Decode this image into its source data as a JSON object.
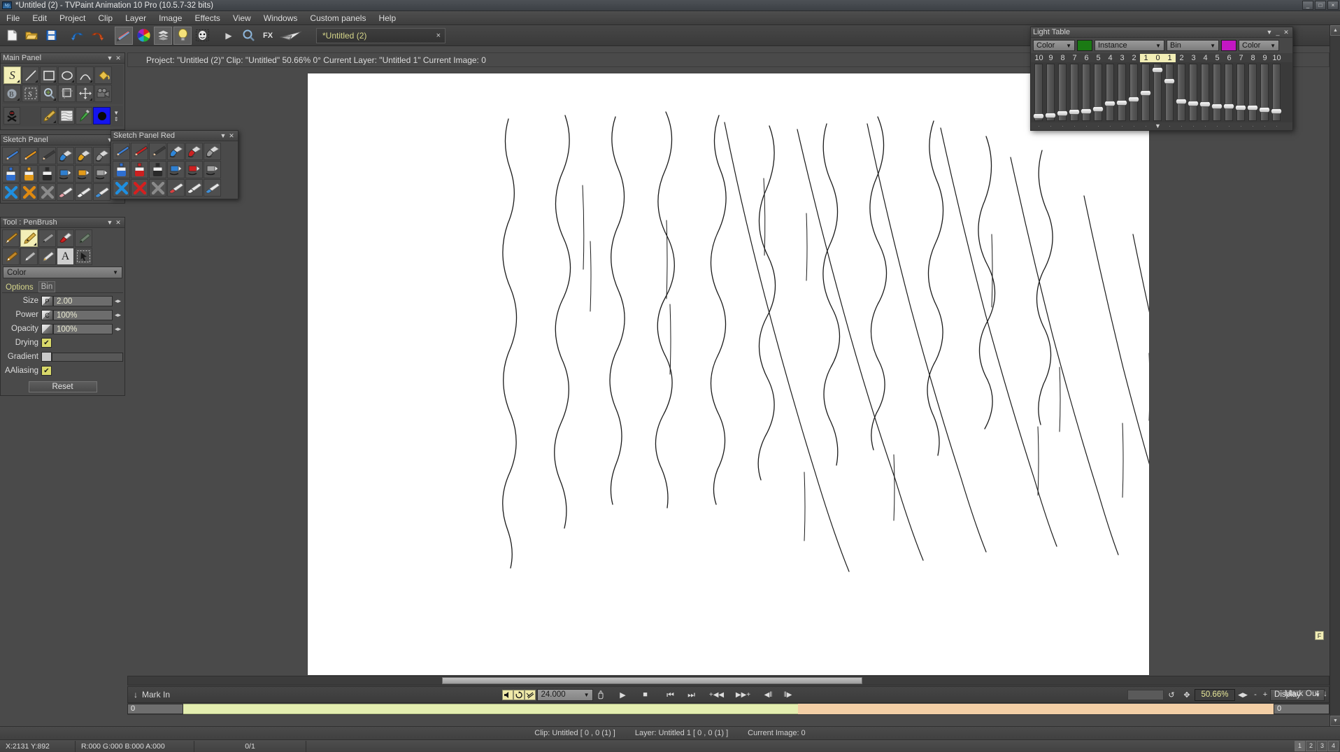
{
  "window": {
    "title": "*Untitled (2) - TVPaint Animation 10 Pro (10.5.7-32 bits)",
    "logo": "tvp",
    "minimize": "_",
    "maximize": "□",
    "close": "×"
  },
  "menu": {
    "items": [
      "File",
      "Edit",
      "Project",
      "Clip",
      "Layer",
      "Image",
      "Effects",
      "View",
      "Windows",
      "Custom panels",
      "Help"
    ]
  },
  "toolbar": {
    "buttons": [
      {
        "name": "new-file-icon",
        "glyph": "📄"
      },
      {
        "name": "open-folder-icon",
        "glyph": "📂"
      },
      {
        "name": "save-icon",
        "glyph": "💾"
      },
      {
        "name": "undo-icon",
        "glyph": "↶"
      },
      {
        "name": "redo-icon",
        "glyph": "↷"
      },
      {
        "name": "brushes-icon",
        "glyph": "✎"
      },
      {
        "name": "color-wheel-icon",
        "glyph": "◉"
      },
      {
        "name": "layers-icon",
        "glyph": "◈"
      },
      {
        "name": "light-bulb-icon",
        "glyph": "💡"
      },
      {
        "name": "mask-icon",
        "glyph": "☻"
      },
      {
        "name": "play-icon",
        "glyph": "▶"
      },
      {
        "name": "zoom-icon",
        "glyph": "🔍"
      },
      {
        "name": "fx-label",
        "glyph": "FX"
      },
      {
        "name": "paper-plane-icon",
        "glyph": "✈"
      }
    ],
    "tab_label": "*Untitled (2)",
    "tab_close": "×"
  },
  "main_panel": {
    "title": "Main Panel",
    "collapse": "▼",
    "close": "✕",
    "tools_row1": [
      {
        "name": "freehand-tool",
        "glyph": "S",
        "selected": true
      },
      {
        "name": "line-tool",
        "glyph": "╱",
        "selected": false
      },
      {
        "name": "rectangle-tool",
        "glyph": "▭",
        "selected": false
      },
      {
        "name": "ellipse-tool",
        "glyph": "◯",
        "selected": false
      },
      {
        "name": "curve-tool",
        "glyph": "∩",
        "selected": false
      },
      {
        "name": "fill-tool",
        "glyph": "🪣",
        "selected": false
      }
    ],
    "tools_row2": [
      {
        "name": "brush-select-tool",
        "glyph": "B",
        "selected": false
      },
      {
        "name": "selection-tool",
        "glyph": "S",
        "selected": false
      },
      {
        "name": "magnifier-tool",
        "glyph": "🔍",
        "selected": false
      },
      {
        "name": "crop-tool",
        "glyph": "⊐",
        "selected": false
      },
      {
        "name": "move-tool",
        "glyph": "✥",
        "selected": false
      },
      {
        "name": "camera-tool",
        "glyph": "🎥",
        "selected": false
      }
    ],
    "tools_row3": [
      {
        "name": "skull-eraser-icon",
        "glyph": "☠"
      },
      {
        "name": "pen-nib-icon",
        "glyph": "✒"
      },
      {
        "name": "paper-texture-icon",
        "glyph": "▨"
      },
      {
        "name": "eyedropper-icon",
        "glyph": "💉"
      },
      {
        "name": "color-swatch-icon",
        "glyph": "●"
      },
      {
        "name": "color-expand-icon",
        "glyph": "▼"
      }
    ]
  },
  "sketch_panel": {
    "title": "Sketch Panel",
    "collapse": "▼",
    "close": "✕",
    "rows": [
      [
        "pencil-blue-icon",
        "pencil-orange-icon",
        "pencil-black-icon",
        "brush-blue-icon",
        "brush-orange-icon",
        "brush-grey-icon"
      ],
      [
        "ink-blue-icon",
        "ink-orange-icon",
        "ink-black-icon",
        "marker-blue-icon",
        "marker-orange-icon",
        "marker-grey-icon"
      ],
      [
        "x-blue-icon",
        "x-orange-icon",
        "x-grey-icon",
        "eraser-pink-icon",
        "eraser-white-icon",
        "eraser-blue-icon"
      ]
    ]
  },
  "sketch_panel_red": {
    "title": "Sketch Panel Red",
    "collapse": "▼",
    "close": "✕",
    "rows": [
      [
        "pencil-blue-icon",
        "pencil-red-icon",
        "pencil-black-icon",
        "brush-blue-icon",
        "brush-red-icon",
        "brush-grey-icon"
      ],
      [
        "ink-blue-icon",
        "ink-red-icon",
        "ink-black-icon",
        "marker-blue-icon",
        "marker-red-icon",
        "marker-grey-icon"
      ],
      [
        "x-blue-icon",
        "x-red-icon",
        "x-grey-icon",
        "eraser-red-icon",
        "eraser-white-icon",
        "eraser-blue-icon"
      ]
    ]
  },
  "tool_panel": {
    "title": "Tool : PenBrush",
    "collapse": "▼",
    "close": "✕",
    "brushes_row1": [
      {
        "name": "brush-flat-tool",
        "selected": false
      },
      {
        "name": "penbrush-tool",
        "selected": true
      },
      {
        "name": "marker-tool",
        "selected": false
      },
      {
        "name": "lipstick-tool",
        "selected": false
      },
      {
        "name": "airbrush-tool",
        "selected": false
      }
    ],
    "brushes_row2": [
      {
        "name": "round-brush-tool",
        "selected": false
      },
      {
        "name": "chalk-tool",
        "selected": false
      },
      {
        "name": "blade-tool",
        "selected": false
      },
      {
        "name": "text-tool",
        "glyph": "A",
        "selected": false
      },
      {
        "name": "pointer-tool",
        "glyph": "↖",
        "selected": false
      }
    ],
    "mode_dropdown": {
      "value": "Color",
      "chevron": "▼"
    },
    "tabs": {
      "options": "Options",
      "bin": "Bin"
    },
    "fields": [
      {
        "name": "size",
        "label": "Size",
        "mini": "P",
        "value": "2.00",
        "arrows": "◀▶"
      },
      {
        "name": "power",
        "label": "Power",
        "mini": "C",
        "value": "100%",
        "arrows": "◀▶"
      },
      {
        "name": "opacity",
        "label": "Opacity",
        "mini": "",
        "value": "100%",
        "arrows": "◀▶"
      }
    ],
    "toggles": [
      {
        "name": "drying",
        "label": "Drying",
        "checked": true,
        "mark": "✔"
      },
      {
        "name": "gradient",
        "label": "Gradient",
        "checked": false,
        "mark": ""
      },
      {
        "name": "aaliasing",
        "label": "AAliasing",
        "checked": true,
        "mark": "✔"
      }
    ],
    "reset_label": "Reset"
  },
  "light_table": {
    "title": "Light Table",
    "collapse": "▼",
    "minimize": "_",
    "close": "✕",
    "controls": {
      "mode": "Color",
      "mode_chevron": "▼",
      "swatch_green": "#1b7a14",
      "instance": "Instance",
      "instance_chevron": "▼",
      "bin": "Bin",
      "bin_chevron": "▼",
      "swatch_magenta": "#c317c3",
      "color": "Color",
      "color_chevron": "▼"
    },
    "scale_labels": [
      "10",
      "9",
      "8",
      "7",
      "6",
      "5",
      "4",
      "3",
      "2",
      "1",
      "0",
      "1",
      "2",
      "3",
      "4",
      "5",
      "6",
      "7",
      "8",
      "9",
      "10"
    ],
    "highlighted_indices": [
      9,
      10,
      11
    ],
    "slider_values": [
      4,
      6,
      9,
      12,
      14,
      17,
      28,
      30,
      36,
      48,
      93,
      72,
      33,
      28,
      27,
      23,
      23,
      20,
      20,
      16,
      14
    ],
    "footer_marker": "▼",
    "footer_dot": "·",
    "right_col": [
      "▼",
      "✕"
    ]
  },
  "info_bar": {
    "collapse_arrow": "◀",
    "text": "Project:  \"Untitled (2)\"  Clip: \"Untitled\"   50.66%  0°  Current Layer: \"Untitled 1\"  Current Image: 0"
  },
  "canvas": {
    "f_badge": "F",
    "strokes_note": "hand-drawn vertical wavy ink lines on white paper"
  },
  "transport": {
    "mark_in_arrow": "↓",
    "mark_in": "Mark In",
    "sound_icon": "🔊",
    "loop_icon": "↺",
    "link_icon": "⛓",
    "fps_value": "24.000",
    "fps_chevron": "▼",
    "hand_icon": "✋",
    "play": "▶",
    "stop": "■",
    "first_frame": "⏮",
    "last_frame": "⏭",
    "prev_mark": "+◀◀",
    "next_mark": "▶▶+",
    "step_back": "◀‖",
    "step_fwd": "‖▶",
    "refresh_icon": "↺",
    "fit_icon": "✥",
    "zoom_value": "50.66%",
    "zoom_arrows": "◀▶",
    "zoom_minus": "-",
    "zoom_plus": "+",
    "display_label": "Display",
    "display_chevron": "▼",
    "mark_out": "Mark Out",
    "mark_out_arrow": "↓",
    "timeline_start": "0",
    "timeline_end": "0"
  },
  "status": {
    "clip": "Clip: Untitled [ 0 , 0  (1) ]",
    "layer": "Layer: Untitled 1 [ 0 , 0  (1) ]",
    "current_image": "Current Image: 0",
    "coords": "X:2131  Y:892",
    "rgba": "R:000 G:000 B:000 A:000",
    "frame_counter": "0/1",
    "pages": [
      "1",
      "2",
      "3",
      "4"
    ],
    "active_page": "1"
  }
}
